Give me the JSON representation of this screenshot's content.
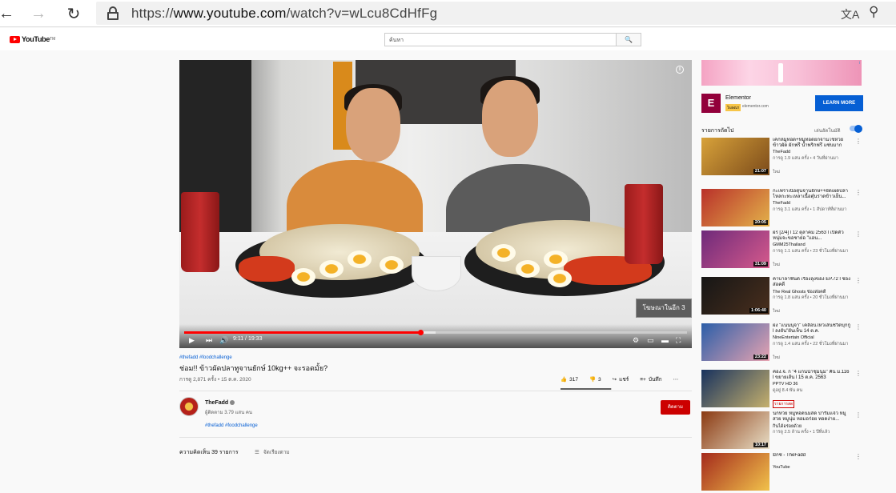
{
  "browser": {
    "back_icon": "←",
    "forward_icon": "→",
    "reload_icon": "↻",
    "url_scheme": "https://",
    "url_host": "www.youtube.com",
    "url_path": "/watch?v=wLcu8CdHfFg",
    "translate_icon": "文A",
    "zoom_icon": "⚲"
  },
  "youtube": {
    "logo_text": "YouTube",
    "logo_tm": "TM",
    "search_placeholder": "ค้นหา",
    "search_icon": "🔍"
  },
  "player": {
    "current_time": "9:11",
    "duration": "19:33",
    "time_display": "9:11 / 19:33",
    "progress_fraction": 0.47,
    "buffered_fraction": 0.5,
    "skip_ad_label": "โฆษณาในอีก 3",
    "info_icon": "i"
  },
  "video": {
    "hashtags": "#thefadd #foodchallenge",
    "title": "ช่อม!! ข้าวผัดปลาทูจานยักษ์ 10kg++ จะรอดมั้ย?",
    "meta": "การดู 2,871 ครั้ง • 15 ต.ค. 2020",
    "likes": "317",
    "dislikes": "3",
    "like_ratio": 0.99,
    "share_label": "แชร์",
    "save_label": "บันทึก",
    "more_label": "⋯"
  },
  "channel": {
    "name": "TheFadd",
    "subscribers": "ผู้ติดตาม 3.79 แสน คน",
    "subscribe_label": "ติดตาม",
    "description_tags": "#thefadd #foodchallenge"
  },
  "comments": {
    "count_label": "ความคิดเห็น 39 รายการ",
    "sort_label": "จัดเรียงตาม"
  },
  "ad": {
    "name": "Elementor",
    "badge": "โฆษณา",
    "site": "elementor.com",
    "cta": "LEARN MORE",
    "info": "i"
  },
  "upnext": {
    "label": "รายการถัดไป",
    "autoplay_label": "เล่นอัตโนมัติ",
    "autoplay_on": true
  },
  "recommendations": [
    {
      "title": "เค้กหมูทอด+หมูทอดยกจานโชห่วยข้าวผัด ผักฟรี น้ำพริกฟรี แซ่บมาก",
      "channel": "TheFadd",
      "meta": "การดู 1.9 แสน ครั้ง • 4 วันที่ผ่านมา",
      "badge": "ใหม่",
      "duration": "21:07",
      "colors": [
        "#d8a23a",
        "#7c4b1a"
      ]
    },
    {
      "title": "กะเพราเนื้อตุ๋นจานยักษ์++ผัดเผ็ดปลาไหลกะทะเหลาเนื้อตุ๋นราดข้าวเย็น...",
      "channel": "TheFadd",
      "meta": "การดู 3.1 แสน ครั้ง • 1 สัปดาห์ที่ผ่านมา",
      "badge": "",
      "duration": "20:05",
      "colors": [
        "#b9302a",
        "#e3b24a"
      ]
    },
    {
      "title": "ผีร [2/4] l 12 ตุลาคม 2563 l เปิดตัวหนุ่มจะขอชาย่อ \"แอน...",
      "channel": "GMM25Thailand",
      "meta": "การดู 1.1 แสน ครั้ง • 23 ชั่วโมงที่ผ่านมา",
      "badge": "ใหม่",
      "duration": "31:09",
      "colors": [
        "#6e2a7a",
        "#d65a8c"
      ]
    },
    {
      "title": "ค้าบาลาฟันดี เรื่องลุงของ EP.72 l ช่องส่อคดี",
      "channel": "The Real Ghosts ช่องส่อคดี",
      "meta": "การดู 1.8 แสน ครั้ง • 20 ชั่วโมงที่ผ่านมา",
      "badge": "ใหม่",
      "duration": "1:06:40",
      "colors": [
        "#161616",
        "#4a2f1d"
      ]
    },
    {
      "title": "ผีง \"แนนนุจา\" เคลื่อนไหวเส้นชีวิตบุกกู้ l ลงยัน\"ผันเห็น 14 ต.ค.",
      "channel": "NineEntertain Official",
      "meta": "การดู 1.4 แสน ครั้ง • 22 ชั่วโมงที่ผ่านมา",
      "badge": "ใหม่",
      "duration": "23:22",
      "colors": [
        "#2b5ea8",
        "#e7a3b1"
      ]
    },
    {
      "title": "ค่อง.จ. ก \"4 แกนนำชุมนุม\" คืน ม.116 l ขยายเส้น l 15 ต.ค. 2563",
      "channel": "PPTV HD 36",
      "meta": "ดูอยู่ 8.4 พัน คน",
      "badge": "รายการสด",
      "duration": "",
      "colors": [
        "#18325e",
        "#c5b06d"
      ]
    },
    {
      "title": "นกหวย หมูทอดนมสด ปาริมแจ๋ว หมูสวย หมูนุ่ม หอมอร่อย ทอดง่าย...",
      "channel": "กินได้อร่อยด้วย",
      "meta": "การดู 2.5 ล้าน ครั้ง • 1 ปีที่แล้ว",
      "badge": "",
      "duration": "10:17",
      "colors": [
        "#8b3a12",
        "#e8dfc7"
      ]
    },
    {
      "title": "มิกซ์ - TheFadd",
      "channel": "YouTube",
      "meta": "",
      "badge": "",
      "duration": "",
      "colors": [
        "#a42a1c",
        "#f1c24b"
      ]
    }
  ]
}
